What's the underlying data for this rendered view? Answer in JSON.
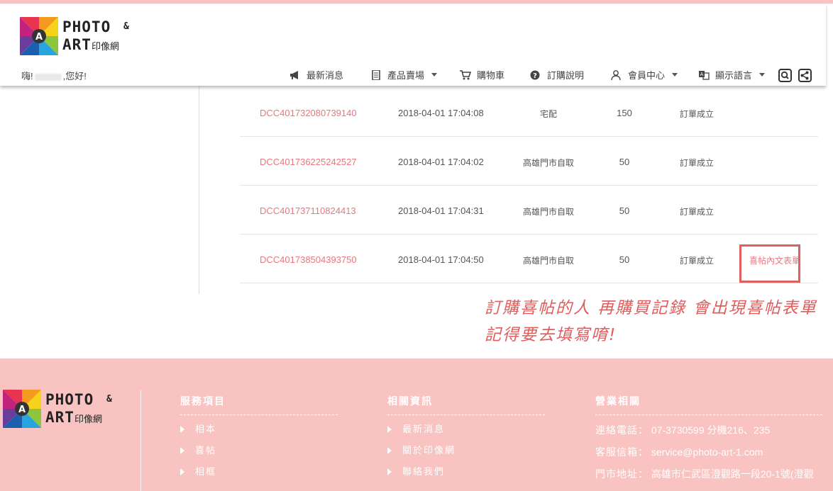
{
  "brand": {
    "logo_line1": "PHOTO",
    "logo_amp": "&",
    "logo_line2": "ART",
    "logo_cn": "印像網"
  },
  "header": {
    "greeting_prefix": "嗨!",
    "greeting_suffix": ",您好!"
  },
  "nav": {
    "news": "最新消息",
    "products": "產品賣場",
    "cart": "購物車",
    "order_help": "訂購說明",
    "member": "會員中心",
    "language": "顯示語言"
  },
  "orders": [
    {
      "id": "DCC401732080739140",
      "date": "2018-04-01 17:04:08",
      "shipping": "宅配",
      "amount": "150",
      "status": "訂單成立",
      "action": ""
    },
    {
      "id": "DCC401736225242527",
      "date": "2018-04-01 17:04:02",
      "shipping": "高雄門市自取",
      "amount": "50",
      "status": "訂單成立",
      "action": ""
    },
    {
      "id": "DCC401737110824413",
      "date": "2018-04-01 17:04:31",
      "shipping": "高雄門市自取",
      "amount": "50",
      "status": "訂單成立",
      "action": ""
    },
    {
      "id": "DCC401738504393750",
      "date": "2018-04-01 17:04:50",
      "shipping": "高雄門市自取",
      "amount": "50",
      "status": "訂單成立",
      "action": "喜帖內文表單"
    }
  ],
  "annotation": {
    "line1": "訂購喜帖的人 再購買記錄 會出現喜帖表單",
    "line2": "記得要去填寫唷!"
  },
  "footer": {
    "services": {
      "title": "服務項目",
      "items": [
        "相本",
        "喜帖",
        "相框"
      ]
    },
    "info": {
      "title": "相關資訊",
      "items": [
        "最新消息",
        "關於印像網",
        "聯絡我們"
      ]
    },
    "business": {
      "title": "營業相關",
      "phone_label": "連絡電話：",
      "phone_value": "07-3730599 分機216、235",
      "email_label": "客服信箱：",
      "email_value": "service@photo-art-1.com",
      "address_label": "門市地址：",
      "address_value": "高雄市仁武區澄觀路一段20-1號(澄觀"
    }
  },
  "colors": {
    "accent_pink": "#f8c3c0",
    "link_red": "#e8777c",
    "annotation_red": "#e25c5c"
  }
}
